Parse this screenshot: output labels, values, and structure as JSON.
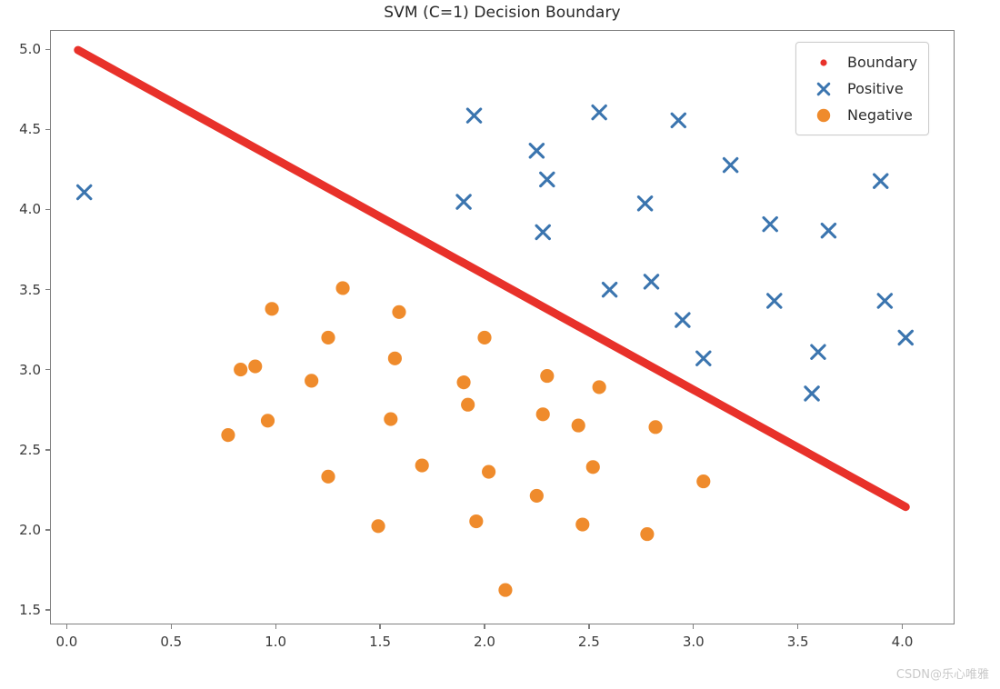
{
  "figure": {
    "title": "SVM (C=1) Decision Boundary",
    "watermark": "CSDN@乐心唯雅"
  },
  "legend": {
    "position": "upper right",
    "entries": [
      {
        "label": "Boundary",
        "marker": "small-red-dot",
        "color": "#e8312a"
      },
      {
        "label": "Positive",
        "marker": "blue-x",
        "color": "#3b75af"
      },
      {
        "label": "Negative",
        "marker": "orange-circle",
        "color": "#ef8b2c"
      }
    ]
  },
  "colors": {
    "boundary": "#e8312a",
    "positive": "#3b75af",
    "negative": "#ef8b2c",
    "axis": "#808080",
    "text": "#3a3a3a",
    "background": "#ffffff"
  },
  "chart_data": {
    "type": "scatter",
    "title": "SVM (C=1) Decision Boundary",
    "xlabel": "",
    "ylabel": "",
    "xlim": [
      -0.08,
      4.25
    ],
    "ylim": [
      1.41,
      5.12
    ],
    "grid": false,
    "legend_position": "upper right",
    "xticks": [
      0.0,
      0.5,
      1.0,
      1.5,
      2.0,
      2.5,
      3.0,
      3.5,
      4.0
    ],
    "xtick_labels": [
      "0.0",
      "0.5",
      "1.0",
      "1.5",
      "2.0",
      "2.5",
      "3.0",
      "3.5",
      "4.0"
    ],
    "yticks": [
      1.5,
      2.0,
      2.5,
      3.0,
      3.5,
      4.0,
      4.5,
      5.0
    ],
    "ytick_labels": [
      "1.5",
      "2.0",
      "2.5",
      "3.0",
      "3.5",
      "4.0",
      "4.5",
      "5.0"
    ],
    "series": [
      {
        "name": "Boundary",
        "type": "line",
        "marker": "small-red-dot",
        "color": "#e8312a",
        "linewidth": 9,
        "endpoints": [
          [
            0.05,
            5.0
          ],
          [
            4.02,
            2.14
          ]
        ],
        "slope": -0.7204,
        "intercept": 5.036
      },
      {
        "name": "Positive",
        "type": "scatter",
        "marker": "x",
        "color": "#3b75af",
        "points": [
          [
            0.08,
            4.11
          ],
          [
            1.9,
            4.05
          ],
          [
            1.95,
            4.59
          ],
          [
            2.25,
            4.37
          ],
          [
            2.28,
            3.86
          ],
          [
            2.3,
            4.19
          ],
          [
            2.55,
            4.61
          ],
          [
            2.6,
            3.5
          ],
          [
            2.77,
            4.04
          ],
          [
            2.8,
            3.55
          ],
          [
            2.93,
            4.56
          ],
          [
            2.95,
            3.31
          ],
          [
            3.05,
            3.07
          ],
          [
            3.18,
            4.28
          ],
          [
            3.37,
            3.91
          ],
          [
            3.39,
            3.43
          ],
          [
            3.57,
            2.85
          ],
          [
            3.6,
            3.11
          ],
          [
            3.65,
            3.87
          ],
          [
            3.9,
            4.18
          ],
          [
            3.92,
            3.43
          ],
          [
            4.02,
            3.2
          ]
        ]
      },
      {
        "name": "Negative",
        "type": "scatter",
        "marker": "o",
        "color": "#ef8b2c",
        "points": [
          [
            0.77,
            2.59
          ],
          [
            0.83,
            3.0
          ],
          [
            0.9,
            3.02
          ],
          [
            0.96,
            2.68
          ],
          [
            0.98,
            3.38
          ],
          [
            1.17,
            2.93
          ],
          [
            1.25,
            2.33
          ],
          [
            1.25,
            3.2
          ],
          [
            1.32,
            3.51
          ],
          [
            1.49,
            2.02
          ],
          [
            1.55,
            2.69
          ],
          [
            1.57,
            3.07
          ],
          [
            1.59,
            3.36
          ],
          [
            1.7,
            2.4
          ],
          [
            1.9,
            2.92
          ],
          [
            1.92,
            2.78
          ],
          [
            1.96,
            2.05
          ],
          [
            2.0,
            3.2
          ],
          [
            2.02,
            2.36
          ],
          [
            2.1,
            1.62
          ],
          [
            2.25,
            2.21
          ],
          [
            2.28,
            2.72
          ],
          [
            2.3,
            2.96
          ],
          [
            2.45,
            2.65
          ],
          [
            2.47,
            2.03
          ],
          [
            2.52,
            2.39
          ],
          [
            2.55,
            2.89
          ],
          [
            2.78,
            1.97
          ],
          [
            2.82,
            2.64
          ],
          [
            3.05,
            2.3
          ]
        ]
      }
    ]
  }
}
